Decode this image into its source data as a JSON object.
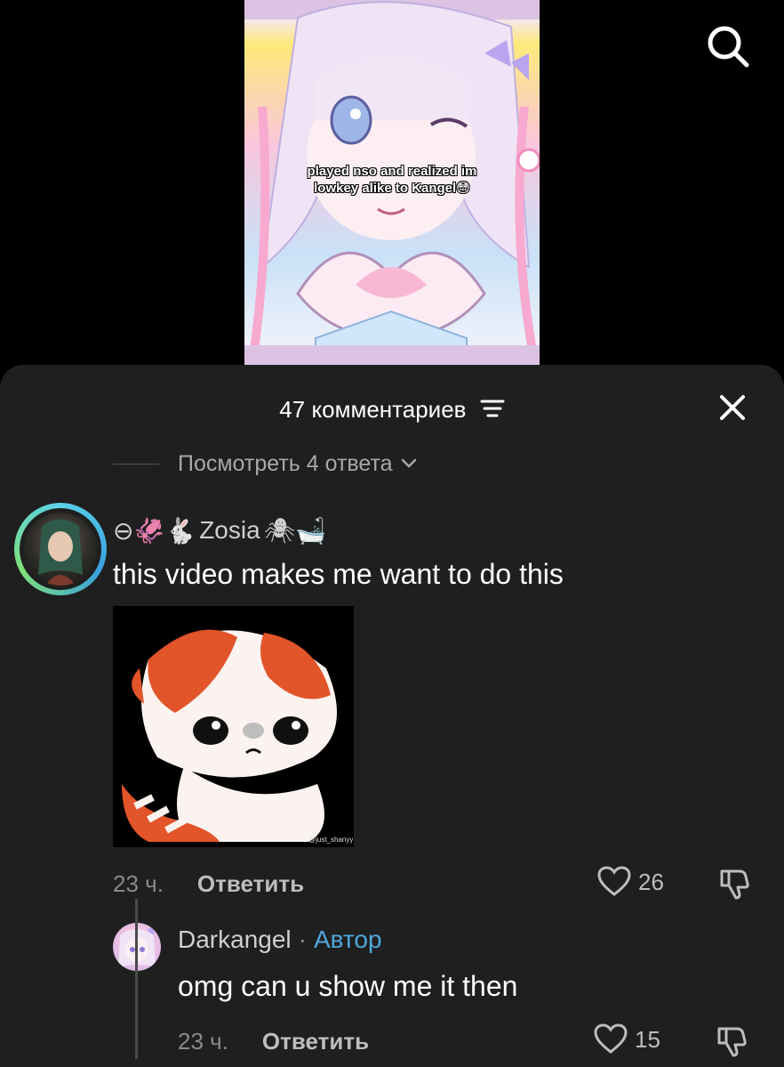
{
  "video": {
    "caption_line1": "played nso and realized im",
    "caption_line2": "lowkey alike to Kangel😳"
  },
  "header": {
    "count_label": "47 комментариев"
  },
  "thread": {
    "view_replies_label": "Посмотреть 4 ответа"
  },
  "comment": {
    "username_prefix_emojis": "⊖🦑🐇",
    "username": "Zosia",
    "username_suffix_emojis": "🕷🛁",
    "text": "this video makes me want to do this",
    "sticker_watermark": "@just_shanyy",
    "time": "23 ч.",
    "reply_label": "Ответить",
    "likes": "26"
  },
  "reply": {
    "username": "Darkangel",
    "separator": "·",
    "author_badge": "Автор",
    "text": "omg can u show me it then",
    "time": "23 ч.",
    "reply_label": "Ответить",
    "likes": "15"
  },
  "colors": {
    "sheet_bg": "#1f1f1f",
    "author_badge": "#4fa7dd",
    "avatar_ring": "#5ad1e9"
  },
  "icons": {
    "search": "search-icon",
    "close": "close-icon",
    "sort": "sort-icon",
    "chevron": "chevron-down-icon",
    "like": "heart-icon",
    "dislike": "thumbs-down-icon"
  }
}
